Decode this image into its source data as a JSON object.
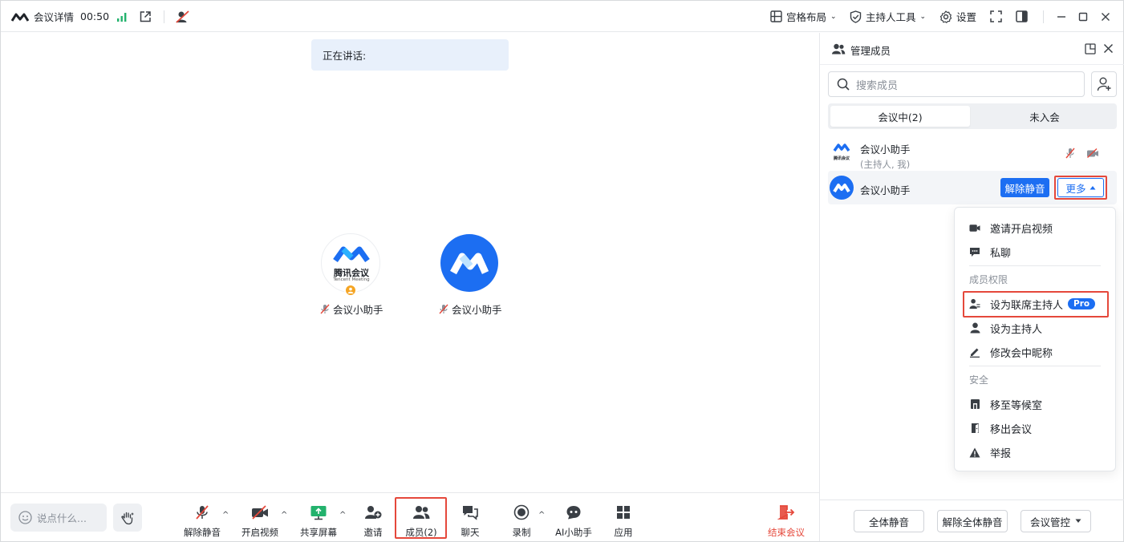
{
  "titlebar": {
    "meeting_info": "会议详情",
    "timer": "00:50",
    "layout": "宫格布局",
    "host_tools": "主持人工具",
    "settings": "设置"
  },
  "stage": {
    "speaking_label": "正在讲话:",
    "tiles": [
      {
        "name": "会议小助手",
        "logo_text": "腾讯会议",
        "logo_sub": "Tencent Meeting"
      },
      {
        "name": "会议小助手"
      }
    ]
  },
  "toolbar": {
    "chat_placeholder": "说点什么...",
    "items": [
      {
        "label": "解除静音"
      },
      {
        "label": "开启视频"
      },
      {
        "label": "共享屏幕"
      },
      {
        "label": "邀请"
      },
      {
        "label": "成员(2)"
      },
      {
        "label": "聊天"
      },
      {
        "label": "录制"
      },
      {
        "label": "AI小助手"
      },
      {
        "label": "应用"
      }
    ],
    "end_meeting": "结束会议"
  },
  "panel": {
    "title": "管理成员",
    "search_placeholder": "搜索成员",
    "tabs": [
      {
        "label": "会议中(2)",
        "active": true
      },
      {
        "label": "未入会",
        "active": false
      }
    ],
    "members": [
      {
        "name": "会议小助手",
        "role": "(主持人, 我)",
        "logo_text": "腾讯会议"
      },
      {
        "name": "会议小助手",
        "unmute": "解除静音",
        "more": "更多"
      }
    ],
    "menu": {
      "items_top": [
        {
          "label": "邀请开启视频",
          "icon": "video-icon"
        },
        {
          "label": "私聊",
          "icon": "chat-bubble-icon"
        }
      ],
      "group_permissions": "成员权限",
      "items_perm": [
        {
          "label": "设为联席主持人",
          "icon": "cohost-icon",
          "badge": "Pro"
        },
        {
          "label": "设为主持人",
          "icon": "person-icon"
        },
        {
          "label": "修改会中昵称",
          "icon": "edit-icon"
        }
      ],
      "group_security": "安全",
      "items_sec": [
        {
          "label": "移至等候室",
          "icon": "waiting-room-icon"
        },
        {
          "label": "移出会议",
          "icon": "exit-door-icon"
        },
        {
          "label": "举报",
          "icon": "warning-icon"
        }
      ]
    },
    "footer": {
      "mute_all": "全体静音",
      "unmute_all": "解除全体静音",
      "meeting_control": "会议管控"
    }
  },
  "colors": {
    "accent": "#1c6ef2",
    "danger": "#e5483b",
    "signal": "#23b26d"
  }
}
